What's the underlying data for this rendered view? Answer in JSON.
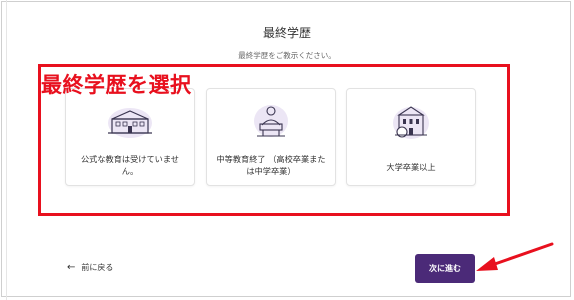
{
  "header": {
    "title": "最終学歴",
    "subtitle": "最終学歴をご教示ください。"
  },
  "annotation": {
    "label": "最終学歴を選択",
    "color": "#e8101e"
  },
  "options": [
    {
      "label": "公式な教育は受けていません。",
      "icon": "school-building-icon"
    },
    {
      "label": "中等教育終了 （高校卒業または中学卒業）",
      "icon": "student-desk-icon"
    },
    {
      "label": "大学卒業以上",
      "icon": "university-building-icon"
    }
  ],
  "footer": {
    "back_label": "前に戻る",
    "next_label": "次に進む",
    "accent_color": "#4b2a78"
  }
}
